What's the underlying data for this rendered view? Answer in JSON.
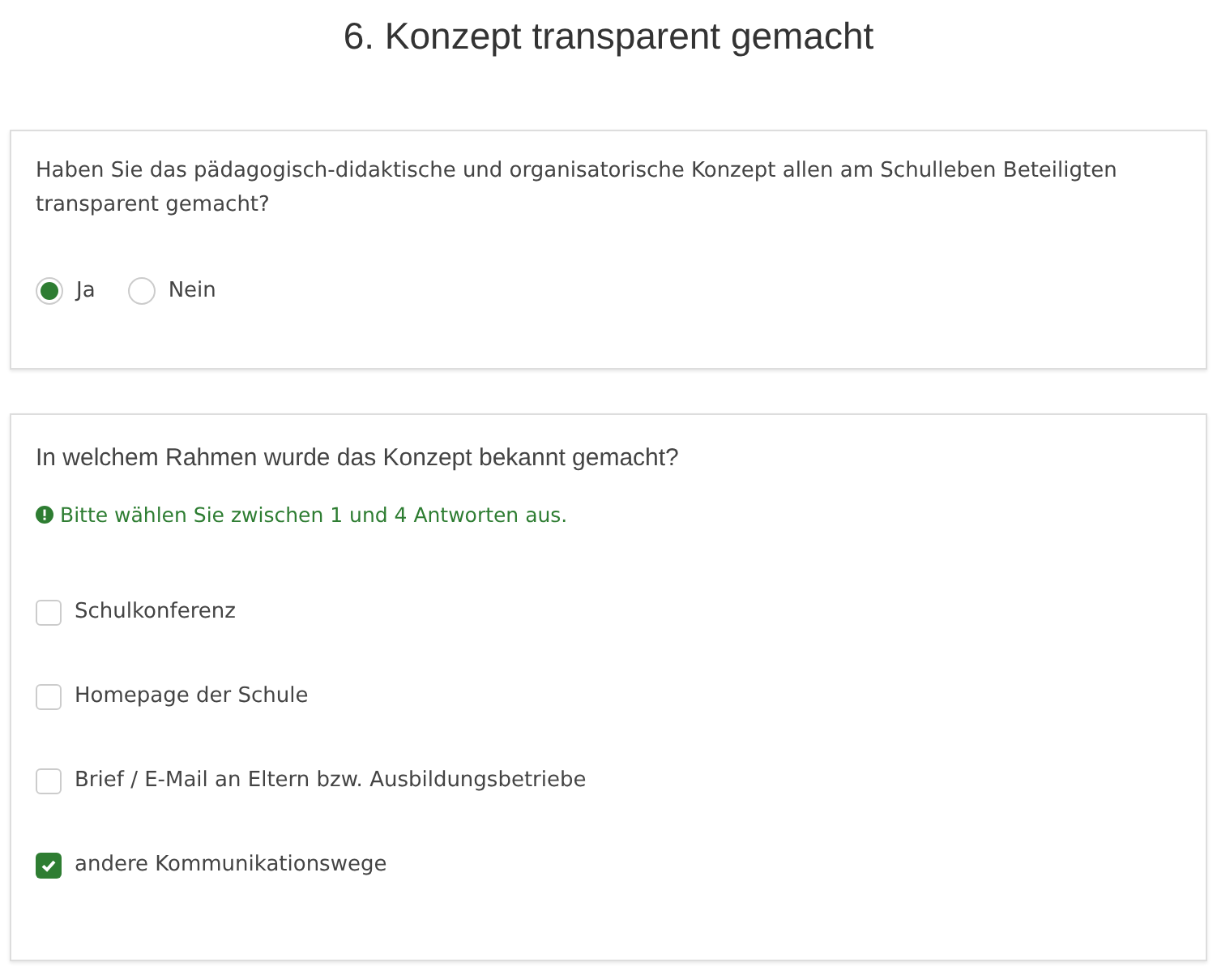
{
  "title": "6. Konzept transparent gemacht",
  "question_1": {
    "text": "Haben Sie das pädagogisch-didaktische und organisatorische Konzept allen am Schulleben Beteiligten transparent gemacht?",
    "options": [
      {
        "label": "Ja",
        "selected": true
      },
      {
        "label": "Nein",
        "selected": false
      }
    ]
  },
  "question_2": {
    "text": "In welchem Rahmen wurde das Konzept bekannt gemacht?",
    "hint": "Bitte wählen Sie zwischen 1 und 4 Antworten aus.",
    "options": [
      {
        "label": "Schulkonferenz",
        "checked": false
      },
      {
        "label": "Homepage der Schule",
        "checked": false
      },
      {
        "label": "Brief / E-Mail an Eltern bzw. Ausbildungsbetriebe",
        "checked": false
      },
      {
        "label": "andere Kommunikationswege",
        "checked": true
      }
    ]
  }
}
